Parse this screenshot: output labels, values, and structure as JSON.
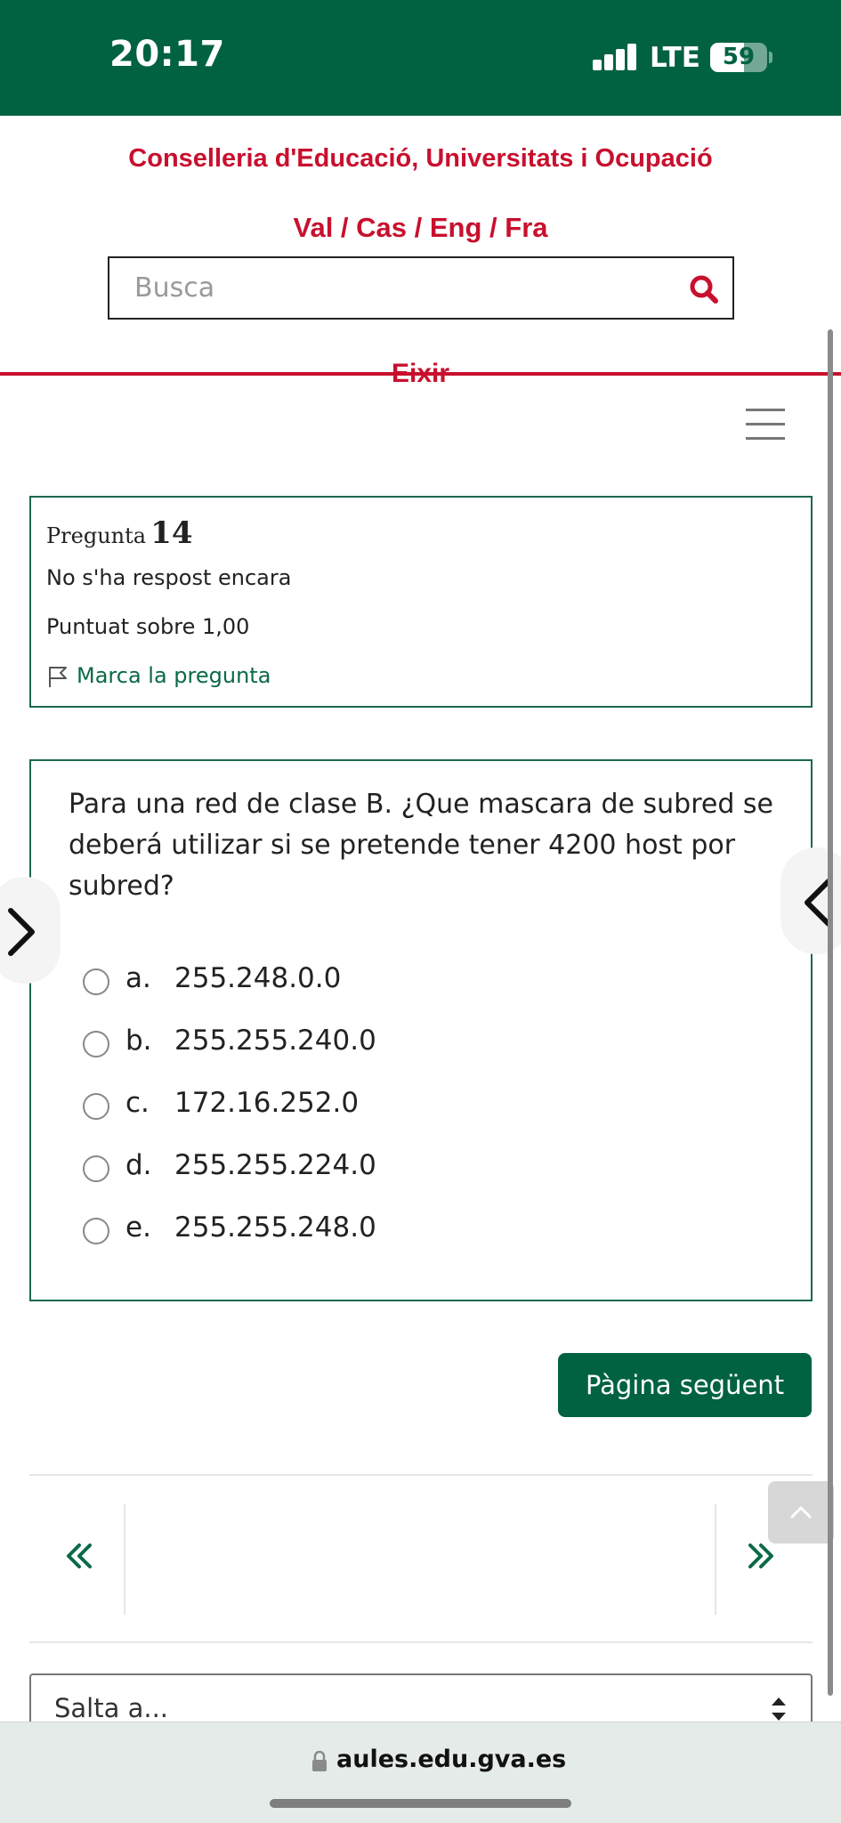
{
  "status_bar": {
    "time": "20:17",
    "network": "LTE",
    "battery_level": "59",
    "bg_color": "#006241"
  },
  "header": {
    "org_title": "Conselleria d'Educació, Universitats i Ocupació",
    "languages": "Val / Cas / Eng / Fra",
    "search_placeholder": "Busca",
    "exit_label": "Eixir",
    "accent_color": "#c8102e"
  },
  "question_info": {
    "label": "Pregunta",
    "number": "14",
    "state": "No s'ha respost encara",
    "grade": "Puntuat sobre 1,00",
    "flag_label": "Marca la pregunta"
  },
  "question": {
    "text": "Para una red de clase B. ¿Que mascara de subred se deberá utilizar si se pretende tener 4200 host por subred?",
    "answers": [
      {
        "letter": "a.",
        "text": "255.248.0.0"
      },
      {
        "letter": "b.",
        "text": "255.255.240.0"
      },
      {
        "letter": "c.",
        "text": "172.16.252.0"
      },
      {
        "letter": "d.",
        "text": "255.255.224.0"
      },
      {
        "letter": "e.",
        "text": "255.255.248.0"
      }
    ]
  },
  "navigation": {
    "next_page_label": "Pàgina següent",
    "jump_placeholder": "Salta a...",
    "button_color": "#006241"
  },
  "browser": {
    "url": "aules.edu.gva.es"
  }
}
